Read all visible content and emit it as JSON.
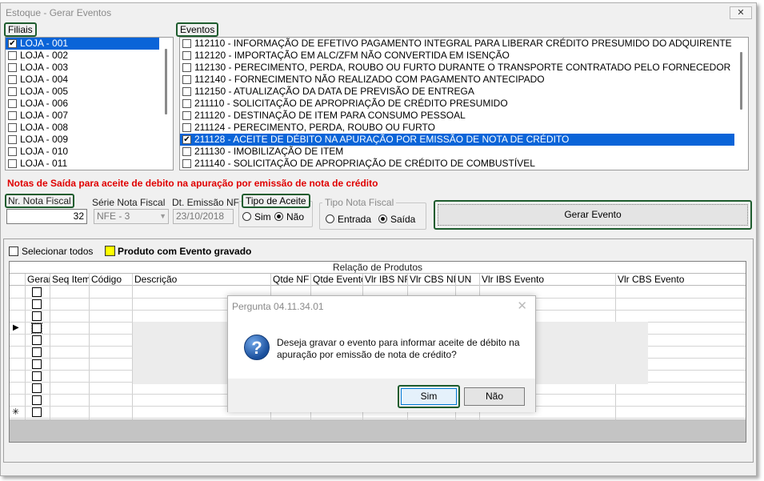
{
  "window": {
    "title": "Estoque - Gerar Eventos",
    "close_glyph": "✕"
  },
  "filiais": {
    "label": "Filiais",
    "items": [
      {
        "label": "LOJA - 001",
        "checked": true,
        "selected": true
      },
      {
        "label": "LOJA - 002",
        "checked": false
      },
      {
        "label": "LOJA - 003",
        "checked": false
      },
      {
        "label": "LOJA - 004",
        "checked": false
      },
      {
        "label": "LOJA - 005",
        "checked": false
      },
      {
        "label": "LOJA - 006",
        "checked": false
      },
      {
        "label": "LOJA - 007",
        "checked": false
      },
      {
        "label": "LOJA - 008",
        "checked": false
      },
      {
        "label": "LOJA - 009",
        "checked": false
      },
      {
        "label": "LOJA - 010",
        "checked": false
      },
      {
        "label": "LOJA - 011",
        "checked": false
      }
    ]
  },
  "eventos": {
    "label": "Eventos",
    "items": [
      {
        "label": "112110 - INFORMAÇÃO DE EFETIVO PAGAMENTO INTEGRAL PARA LIBERAR CRÉDITO PRESUMIDO DO ADQUIRENTE",
        "checked": false
      },
      {
        "label": "112120 - IMPORTAÇÃO EM ALC/ZFM NÃO CONVERTIDA EM ISENÇÃO",
        "checked": false
      },
      {
        "label": "112130 - PERECIMENTO, PERDA, ROUBO OU FURTO DURANTE O TRANSPORTE CONTRATADO PELO FORNECEDOR",
        "checked": false
      },
      {
        "label": "112140 - FORNECIMENTO NÃO REALIZADO COM PAGAMENTO ANTECIPADO",
        "checked": false
      },
      {
        "label": "112150 - ATUALIZAÇÃO DA DATA DE PREVISÃO DE ENTREGA",
        "checked": false
      },
      {
        "label": "211110 - SOLICITAÇÃO DE APROPRIAÇÃO DE CRÉDITO PRESUMIDO",
        "checked": false
      },
      {
        "label": "211120 - DESTINAÇÃO DE ITEM PARA CONSUMO PESSOAL",
        "checked": false
      },
      {
        "label": "211124 - PERECIMENTO, PERDA, ROUBO OU FURTO",
        "checked": false
      },
      {
        "label": "211128 - ACEITE DE DÉBITO NA APURAÇÃO POR EMISSÃO DE NOTA DE CRÉDITO",
        "checked": true,
        "selected": true
      },
      {
        "label": "211130 - IMOBILIZAÇÃO DE ITEM",
        "checked": false
      },
      {
        "label": "211140 - SOLICITAÇÃO DE APROPRIAÇÃO DE CRÉDITO DE COMBUSTÍVEL",
        "checked": false
      }
    ]
  },
  "notice": "Notas de Saída para aceite de debito na apuração por emissão de nota de crédito",
  "form": {
    "nr_nota_label": "Nr. Nota Fiscal",
    "nr_nota_value": "32",
    "serie_label": "Série Nota Fiscal",
    "serie_value": "NFE - 3",
    "dt_emissao_label": "Dt. Emissão NF",
    "dt_emissao_value": "23/10/2018",
    "tipo_aceite_label": "Tipo de Aceite",
    "tipo_aceite_options": [
      "Sim",
      "Não"
    ],
    "tipo_aceite_selected": "Não",
    "tipo_nota_label": "Tipo Nota Fiscal",
    "tipo_nota_options": [
      "Entrada",
      "Saída"
    ],
    "tipo_nota_selected": "Saída",
    "gerar_button": "Gerar Evento"
  },
  "products": {
    "select_all_label": "Selecionar todos",
    "legend_label": "Produto com Evento gravado",
    "legend_color": "#ffff00",
    "caption": "Relação de Produtos",
    "columns": [
      "Gerar",
      "Seq Item",
      "Código",
      "Descrição",
      "Qtde NF",
      "Qtde Evento",
      "Vlr IBS NF",
      "Vlr CBS NF",
      "UN",
      "Vlr IBS Evento",
      "Vlr CBS Evento"
    ],
    "current_row_glyph": "▶",
    "new_row_glyph": "✳"
  },
  "dialog": {
    "title": "Pergunta 04.11.34.01",
    "message": "Deseja gravar o evento para informar aceite de débito na apuração por emissão de nota de crédito?",
    "icon": "question-icon",
    "icon_glyph": "?",
    "yes": "Sim",
    "no": "Não",
    "close_glyph": "✕"
  }
}
